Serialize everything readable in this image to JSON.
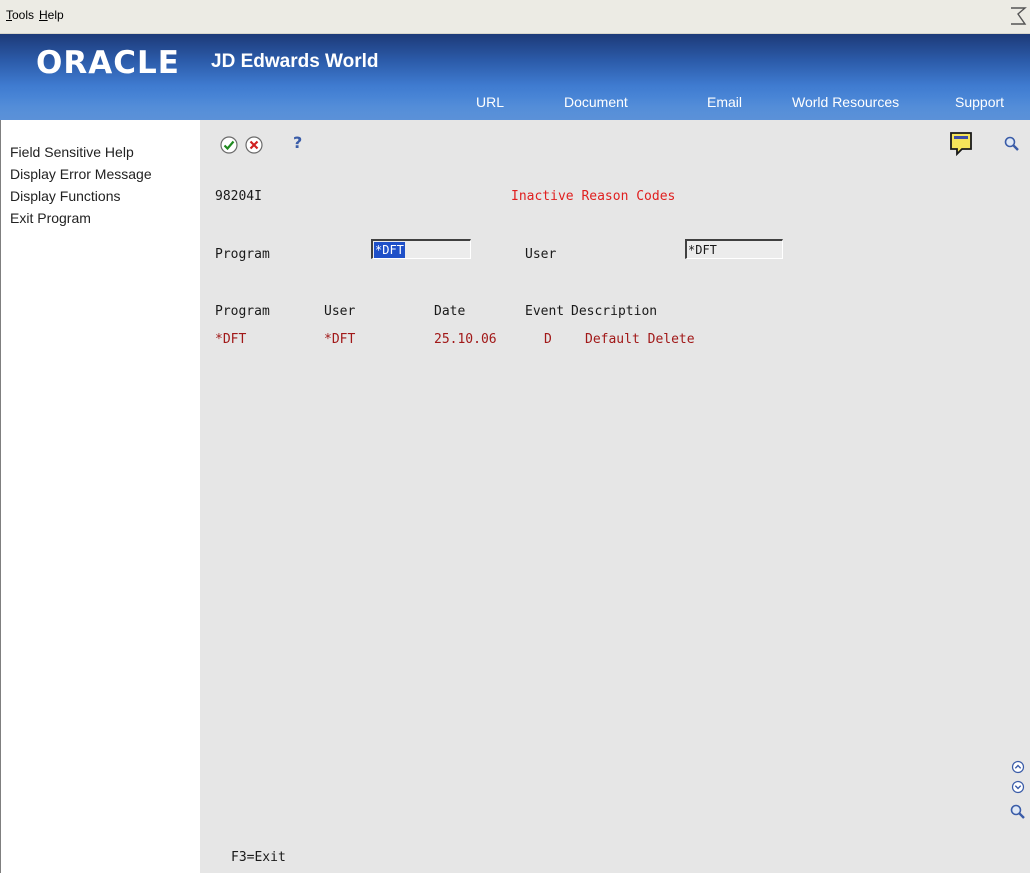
{
  "menubar": {
    "items": [
      {
        "label": "Tools",
        "ul": "T",
        "rest": "ools"
      },
      {
        "label": "Help",
        "ul": "H",
        "rest": "elp"
      }
    ]
  },
  "banner": {
    "logo_brand": "ORACLE",
    "logo_product": "JD Edwards World",
    "nav": [
      "URL",
      "Document",
      "Email",
      "World Resources",
      "Support"
    ]
  },
  "left_panel": {
    "items": [
      "Field Sensitive Help",
      "Display Error Message",
      "Display Functions",
      "Exit Program"
    ]
  },
  "form": {
    "form_id": "98204I",
    "title": "Inactive Reason Codes",
    "program_label": "Program",
    "program_value": "*DFT",
    "user_label": "User",
    "user_value": "*DFT",
    "columns": [
      "Program",
      "User",
      "Date",
      "Event",
      "Description"
    ],
    "rows": [
      {
        "program": "*DFT",
        "user": "*DFT",
        "date": "25.10.06",
        "event": "D",
        "description": "Default Delete"
      }
    ],
    "footer": "F3=Exit"
  },
  "icons": {
    "ok": "checkmark-icon",
    "cancel": "cancel-icon",
    "help": "question-icon",
    "memo": "memo-icon",
    "search": "search-icon",
    "page_up": "page-up-icon",
    "page_down": "page-down-icon"
  },
  "colors": {
    "title_red": "#e01f1f",
    "row_red": "#a11818",
    "banner_blue": "#2b5aa8",
    "selection_blue": "#1f50c8"
  }
}
